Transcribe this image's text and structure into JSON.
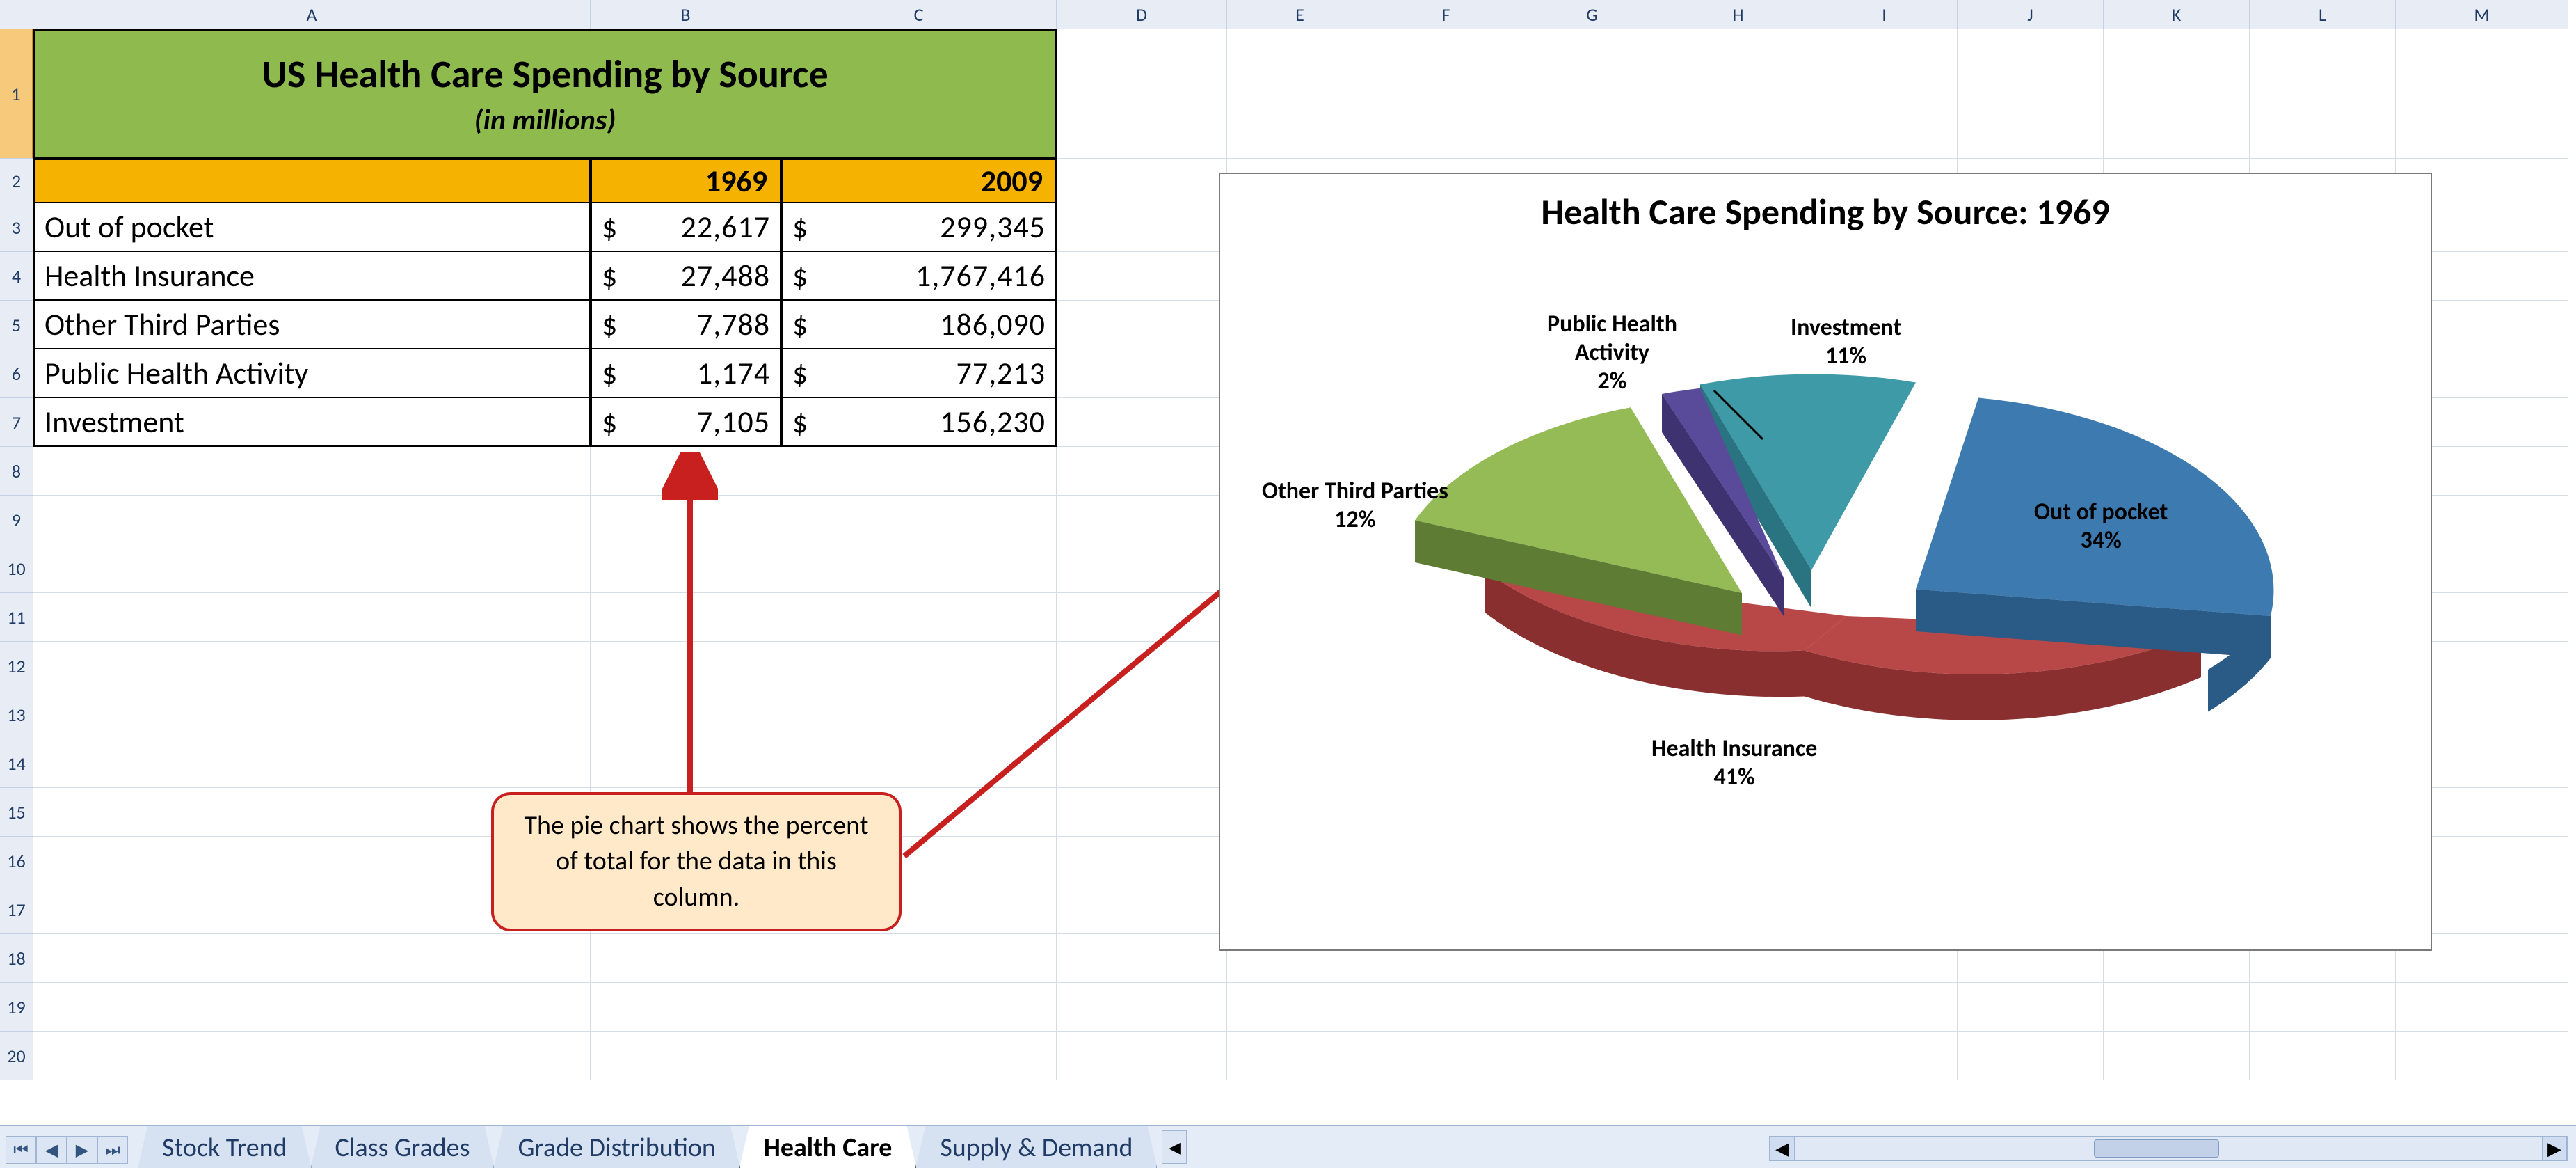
{
  "columns": [
    "A",
    "B",
    "C",
    "D",
    "E",
    "F",
    "G",
    "H",
    "I",
    "J",
    "K",
    "L",
    "M"
  ],
  "row_numbers": [
    1,
    2,
    3,
    4,
    5,
    6,
    7,
    8,
    9,
    10,
    11,
    12,
    13,
    14,
    15,
    16,
    17,
    18,
    19,
    20
  ],
  "title": {
    "line1": "US Health Care Spending by Source",
    "line2": "(in millions)"
  },
  "headers": {
    "a": "",
    "b": "1969",
    "c": "2009"
  },
  "rows": [
    {
      "name": "Out of pocket",
      "y1969": "22,617",
      "y2009": "299,345"
    },
    {
      "name": "Health Insurance",
      "y1969": "27,488",
      "y2009": "1,767,416"
    },
    {
      "name": "Other Third Parties",
      "y1969": "7,788",
      "y2009": "186,090"
    },
    {
      "name": "Public Health Activity",
      "y1969": "1,174",
      "y2009": "77,213"
    },
    {
      "name": "Investment",
      "y1969": "7,105",
      "y2009": "156,230"
    }
  ],
  "callout": "The pie chart shows the percent of total for the data in this column.",
  "chart_title": "Health Care Spending by Source: 1969",
  "pie_labels": {
    "out": {
      "l1": "Out of pocket",
      "l2": "34%"
    },
    "hi": {
      "l1": "Health Insurance",
      "l2": "41%"
    },
    "otp": {
      "l1": "Other Third Parties",
      "l2": "12%"
    },
    "pha": {
      "l1": "Public Health",
      "l2b": "Activity",
      "l3": "2%"
    },
    "inv": {
      "l1": "Investment",
      "l2": "11%"
    }
  },
  "tabs": {
    "items": [
      "Stock Trend",
      "Class Grades",
      "Grade Distribution",
      "Health Care",
      "Supply & Demand"
    ],
    "active_index": 3
  },
  "chart_data": {
    "type": "pie",
    "title": "Health Care Spending by Source: 1969",
    "categories": [
      "Out of pocket",
      "Health Insurance",
      "Other Third Parties",
      "Public Health Activity",
      "Investment"
    ],
    "values_raw": [
      22617,
      27488,
      7788,
      1174,
      7105
    ],
    "values_percent": [
      34,
      41,
      12,
      2,
      11
    ],
    "value_unit": "millions USD",
    "legend_position": "around-slices",
    "exploded": true,
    "three_d": true
  }
}
